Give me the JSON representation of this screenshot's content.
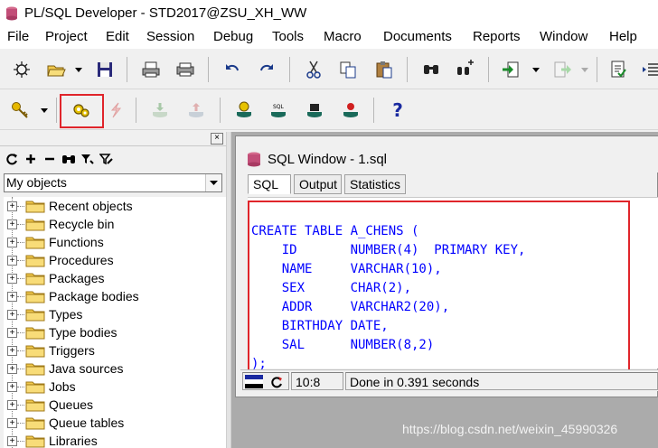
{
  "window": {
    "title": "PL/SQL Developer - STD2017@ZSU_XH_WW"
  },
  "menu": {
    "items": [
      "File",
      "Project",
      "Edit",
      "Session",
      "Debug",
      "Tools",
      "Macro",
      "Documents",
      "Reports",
      "Window",
      "Help"
    ]
  },
  "toolbar1": {
    "icons": [
      "new-icon",
      "open-icon",
      "save-icon",
      "print-icon",
      "print-preview-icon",
      "undo-icon",
      "redo-icon",
      "cut-icon",
      "copy-icon",
      "paste-icon",
      "find-icon",
      "find-next-icon",
      "import-icon",
      "export-icon",
      "report-icon",
      "indent-icon"
    ]
  },
  "toolbar2": {
    "icons": [
      "key-icon",
      "gears-icon",
      "break-icon",
      "commit-icon",
      "rollback-icon",
      "db-execute-icon",
      "sql-icon",
      "db-step-icon",
      "db-break-icon",
      "help-icon"
    ],
    "help_glyph": "?"
  },
  "browser": {
    "close_glyph": "×",
    "select_value": "My objects",
    "items": [
      "Recent objects",
      "Recycle bin",
      "Functions",
      "Procedures",
      "Packages",
      "Package bodies",
      "Types",
      "Type bodies",
      "Triggers",
      "Java sources",
      "Jobs",
      "Queues",
      "Queue tables",
      "Libraries"
    ]
  },
  "sql_window": {
    "title": "SQL Window - 1.sql",
    "tabs": [
      "SQL",
      "Output",
      "Statistics"
    ],
    "code_lines": [
      "CREATE TABLE A_CHENS (",
      "    ID       NUMBER(4)  PRIMARY KEY,",
      "    NAME     VARCHAR(10),",
      "    SEX      CHAR(2),",
      "    ADDR     VARCHAR2(20),",
      "    BIRTHDAY DATE,",
      "    SAL      NUMBER(8,2)",
      ");"
    ],
    "status": {
      "position": "10:8",
      "message": "Done in 0.391 seconds"
    }
  },
  "watermark": "https://blog.csdn.net/weixin_45990326",
  "colors": {
    "highlight_box": "#e0252b",
    "keyword": "#0000ff"
  }
}
